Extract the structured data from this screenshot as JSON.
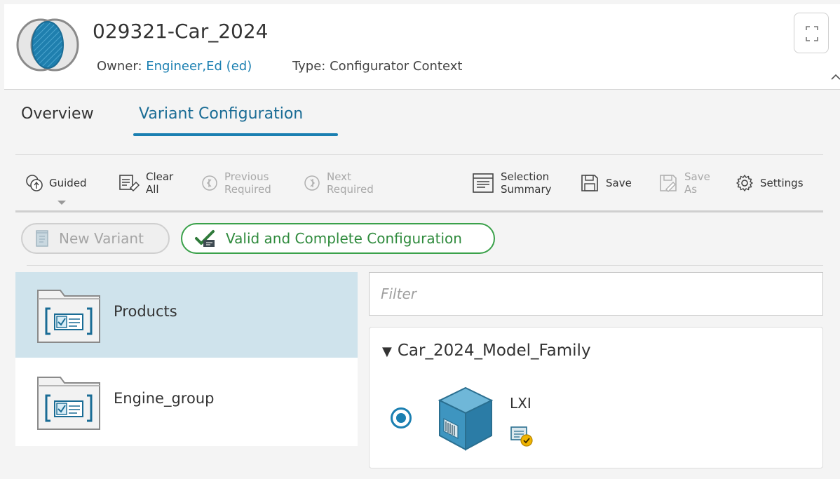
{
  "header": {
    "title": "029321-Car_2024",
    "owner_label": "Owner:",
    "owner_value": "Engineer,Ed (ed)",
    "type_label": "Type:",
    "type_value": "Configurator Context"
  },
  "tabs": [
    {
      "label": "Overview",
      "active": false
    },
    {
      "label": "Variant Configuration",
      "active": true
    }
  ],
  "toolbar": {
    "guided": "Guided",
    "clear_all_1": "Clear",
    "clear_all_2": "All",
    "previous_required_1": "Previous",
    "previous_required_2": "Required",
    "next_required_1": "Next",
    "next_required_2": "Required",
    "selection_summary_1": "Selection",
    "selection_summary_2": "Summary",
    "save": "Save",
    "save_as_1": "Save",
    "save_as_2": "As",
    "settings": "Settings"
  },
  "status": {
    "new_variant": "New Variant",
    "valid_complete": "Valid and Complete Configuration"
  },
  "groups": [
    {
      "label": "Products",
      "selected": true
    },
    {
      "label": "Engine_group",
      "selected": false
    }
  ],
  "filter": {
    "placeholder": "Filter"
  },
  "family": {
    "name": "Car_2024_Model_Family",
    "options": [
      {
        "label": "LXI",
        "selected": true
      }
    ]
  },
  "colors": {
    "accent": "#1a7fb1",
    "valid": "#3aa14a",
    "selected_row": "#cfe3ec"
  }
}
